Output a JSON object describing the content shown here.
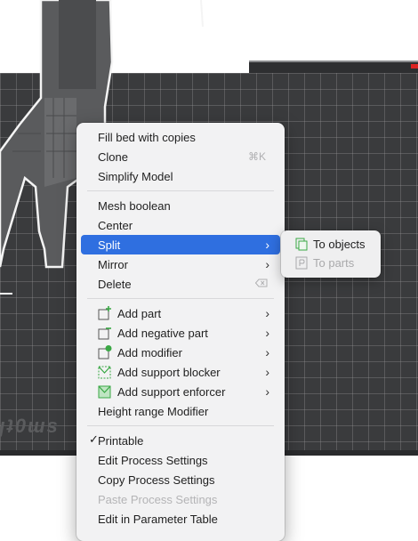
{
  "context_menu": {
    "section1": {
      "fill_bed": "Fill bed with copies",
      "clone": "Clone",
      "clone_shortcut": "⌘K",
      "simplify": "Simplify Model"
    },
    "section2": {
      "mesh_boolean": "Mesh boolean",
      "center": "Center",
      "split": "Split",
      "mirror": "Mirror",
      "delete": "Delete"
    },
    "section3": {
      "add_part": "Add part",
      "add_negative_part": "Add negative part",
      "add_modifier": "Add modifier",
      "add_support_blocker": "Add support blocker",
      "add_support_enforcer": "Add support enforcer",
      "height_range_modifier": "Height range Modifier"
    },
    "section4": {
      "printable": "Printable",
      "edit_process_settings": "Edit Process Settings",
      "copy_process_settings": "Copy Process Settings",
      "paste_process_settings": "Paste Process Settings",
      "edit_in_parameter_table": "Edit in Parameter Table"
    }
  },
  "submenu_split": {
    "to_objects": "To objects",
    "to_parts": "To parts"
  },
  "colors": {
    "highlight": "#2f6fe0",
    "menu_bg": "#f2f2f3",
    "bed": "#3a3b3d",
    "icon_green": "#3aa845"
  },
  "icons": {
    "submenu_arrow": "›",
    "check": "✓"
  }
}
